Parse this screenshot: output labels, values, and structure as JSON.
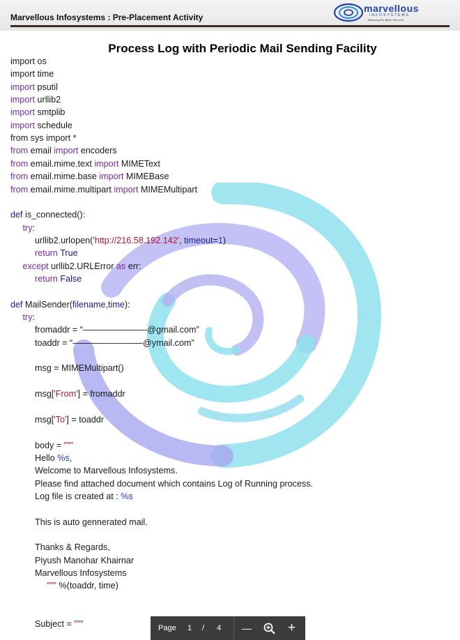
{
  "header": {
    "title": "Marvellous Infosystems : Pre-Placement Activity",
    "logo_text": "marvellous",
    "logo_sub": "INFOSYSTEMS",
    "logo_tagline": "Educating For Better Tomorrow"
  },
  "document": {
    "title": "Process Log with Periodic Mail Sending Facility"
  },
  "code_lines": [
    {
      "indent": 0,
      "parts": [
        [
          "p",
          "import os"
        ]
      ]
    },
    {
      "indent": 0,
      "parts": [
        [
          "p",
          "import time"
        ]
      ]
    },
    {
      "indent": 0,
      "parts": [
        [
          "kw",
          "import"
        ],
        [
          "p",
          " psutil"
        ]
      ]
    },
    {
      "indent": 0,
      "parts": [
        [
          "kw",
          "import"
        ],
        [
          "p",
          " urllib2"
        ]
      ]
    },
    {
      "indent": 0,
      "parts": [
        [
          "kw",
          "import"
        ],
        [
          "p",
          " smtplib"
        ]
      ]
    },
    {
      "indent": 0,
      "parts": [
        [
          "kw",
          "import"
        ],
        [
          "p",
          " schedule"
        ]
      ]
    },
    {
      "indent": 0,
      "parts": [
        [
          "p",
          "from sys import *"
        ]
      ]
    },
    {
      "indent": 0,
      "parts": [
        [
          "kw",
          "from"
        ],
        [
          "p",
          " email "
        ],
        [
          "kw",
          "import"
        ],
        [
          "p",
          " encoders"
        ]
      ]
    },
    {
      "indent": 0,
      "parts": [
        [
          "kw",
          "from"
        ],
        [
          "p",
          " email.mime.text "
        ],
        [
          "kw",
          "import"
        ],
        [
          "p",
          " MIMEText"
        ]
      ]
    },
    {
      "indent": 0,
      "parts": [
        [
          "kw",
          "from"
        ],
        [
          "p",
          " email.mime.base "
        ],
        [
          "kw",
          "import"
        ],
        [
          "p",
          " MIMEBase"
        ]
      ]
    },
    {
      "indent": 0,
      "parts": [
        [
          "kw",
          "from"
        ],
        [
          "p",
          " email.mime.multipart "
        ],
        [
          "kw",
          "import"
        ],
        [
          "p",
          " MIMEMultipart"
        ]
      ]
    },
    {
      "indent": 0,
      "parts": []
    },
    {
      "indent": 0,
      "parts": [
        [
          "fn",
          "def"
        ],
        [
          "p",
          " is_connected():"
        ]
      ]
    },
    {
      "indent": 1,
      "parts": [
        [
          "kw",
          "try"
        ],
        [
          "p",
          ":"
        ]
      ]
    },
    {
      "indent": 2,
      "parts": [
        [
          "p",
          "urllib2.urlopen("
        ],
        [
          "str",
          "'http://216.58.192.142'"
        ],
        [
          "p",
          ", "
        ],
        [
          "fn",
          "timeout"
        ],
        [
          "p",
          "="
        ],
        [
          "lit",
          "1"
        ],
        [
          "p",
          ")"
        ]
      ]
    },
    {
      "indent": 2,
      "parts": [
        [
          "kw",
          "return"
        ],
        [
          "p",
          " "
        ],
        [
          "fn",
          "True"
        ]
      ]
    },
    {
      "indent": 1,
      "parts": [
        [
          "kw",
          "except"
        ],
        [
          "p",
          " urllib2.URLError "
        ],
        [
          "kw",
          "as"
        ],
        [
          "p",
          " err:"
        ]
      ]
    },
    {
      "indent": 2,
      "parts": [
        [
          "kw",
          "return"
        ],
        [
          "p",
          " "
        ],
        [
          "fn",
          "False"
        ]
      ]
    },
    {
      "indent": 0,
      "parts": []
    },
    {
      "indent": 0,
      "parts": [
        [
          "fn",
          "def"
        ],
        [
          "p",
          " MailSender("
        ],
        [
          "fn",
          "filename"
        ],
        [
          "p",
          ","
        ],
        [
          "fn",
          "time"
        ],
        [
          "p",
          "):"
        ]
      ]
    },
    {
      "indent": 1,
      "parts": [
        [
          "kw",
          "try"
        ],
        [
          "p",
          ":"
        ]
      ]
    },
    {
      "indent": 2,
      "parts": [
        [
          "p",
          "fromaddr = “———————-@gmail.com”"
        ]
      ]
    },
    {
      "indent": 2,
      "parts": [
        [
          "p",
          "toaddr = “————————@ymail.com”"
        ]
      ]
    },
    {
      "indent": 0,
      "parts": []
    },
    {
      "indent": 2,
      "parts": [
        [
          "p",
          "msg = MIMEMultipart()"
        ]
      ]
    },
    {
      "indent": 0,
      "parts": []
    },
    {
      "indent": 2,
      "parts": [
        [
          "p",
          "msg["
        ],
        [
          "str",
          "'From'"
        ],
        [
          "p",
          "] = fromaddr"
        ]
      ]
    },
    {
      "indent": 0,
      "parts": []
    },
    {
      "indent": 2,
      "parts": [
        [
          "p",
          "msg["
        ],
        [
          "str",
          "'To'"
        ],
        [
          "p",
          "] = toaddr"
        ]
      ]
    },
    {
      "indent": 0,
      "parts": []
    },
    {
      "indent": 2,
      "parts": [
        [
          "p",
          "body = "
        ],
        [
          "str",
          "\"\"\""
        ]
      ]
    },
    {
      "indent": 2,
      "parts": [
        [
          "p",
          "Hello "
        ],
        [
          "lit",
          "%s"
        ],
        [
          "p",
          ","
        ]
      ]
    },
    {
      "indent": 2,
      "parts": [
        [
          "p",
          "Welcome to Marvellous Infosystems."
        ]
      ]
    },
    {
      "indent": 2,
      "parts": [
        [
          "p",
          "Please find attached document which contains Log of Running process."
        ]
      ]
    },
    {
      "indent": 2,
      "parts": [
        [
          "p",
          "Log file is created at : "
        ],
        [
          "lit",
          "%s"
        ]
      ]
    },
    {
      "indent": 0,
      "parts": []
    },
    {
      "indent": 2,
      "parts": [
        [
          "p",
          "This is auto gennerated mail."
        ]
      ]
    },
    {
      "indent": 0,
      "parts": []
    },
    {
      "indent": 2,
      "parts": [
        [
          "p",
          "Thanks & Regards,"
        ]
      ]
    },
    {
      "indent": 2,
      "parts": [
        [
          "p",
          "Piyush Manohar Khairnar"
        ]
      ]
    },
    {
      "indent": 2,
      "parts": [
        [
          "p",
          "Marvellous Infosystems"
        ]
      ]
    },
    {
      "indent": 3,
      "parts": [
        [
          "str",
          "\"\"\""
        ],
        [
          "p",
          " %(toaddr, time)"
        ]
      ]
    },
    {
      "indent": 0,
      "parts": []
    },
    {
      "indent": 0,
      "parts": []
    },
    {
      "indent": 2,
      "parts": [
        [
          "p",
          "Subject = "
        ],
        [
          "str",
          "\"\"\""
        ]
      ]
    }
  ],
  "toolbar": {
    "page_label": "Page",
    "current_page": "1",
    "separator": "/",
    "total_pages": "4",
    "zoom_out": "—",
    "zoom_in": "+"
  }
}
